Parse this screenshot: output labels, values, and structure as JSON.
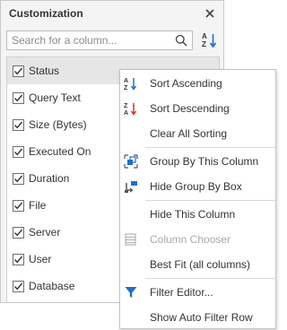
{
  "panel": {
    "title": "Customization",
    "close_symbol": "✕",
    "search": {
      "placeholder": "Search for a column...",
      "value": ""
    },
    "columns": [
      {
        "label": "Status",
        "checked": true,
        "selected": true
      },
      {
        "label": "Query Text",
        "checked": true,
        "selected": false
      },
      {
        "label": "Size (Bytes)",
        "checked": true,
        "selected": false
      },
      {
        "label": "Executed On",
        "checked": true,
        "selected": false
      },
      {
        "label": "Duration",
        "checked": true,
        "selected": false
      },
      {
        "label": "File",
        "checked": true,
        "selected": false
      },
      {
        "label": "Server",
        "checked": true,
        "selected": false
      },
      {
        "label": "User",
        "checked": true,
        "selected": false
      },
      {
        "label": "Database",
        "checked": true,
        "selected": false
      }
    ]
  },
  "menu": {
    "items": [
      {
        "label": "Sort Ascending",
        "icon": "sort-ascending-icon",
        "disabled": false
      },
      {
        "label": "Sort Descending",
        "icon": "sort-descending-icon",
        "disabled": false
      },
      {
        "label": "Clear All Sorting",
        "icon": "",
        "disabled": false
      },
      {
        "label": "Group By This Column",
        "icon": "group-by-column-icon",
        "disabled": false
      },
      {
        "label": "Hide Group By Box",
        "icon": "hide-group-box-icon",
        "disabled": false
      },
      {
        "label": "Hide This Column",
        "icon": "",
        "disabled": false
      },
      {
        "label": "Column Chooser",
        "icon": "column-chooser-icon",
        "disabled": true
      },
      {
        "label": "Best Fit (all columns)",
        "icon": "",
        "disabled": false
      },
      {
        "label": "Filter Editor...",
        "icon": "filter-icon",
        "disabled": false
      },
      {
        "label": "Show Auto Filter Row",
        "icon": "",
        "disabled": false
      }
    ]
  },
  "colors": {
    "accent_blue": "#1e6fc6",
    "accent_red": "#d9342b",
    "panel_bg": "#f4f4f4",
    "selected_row": "#e6e6e6"
  }
}
